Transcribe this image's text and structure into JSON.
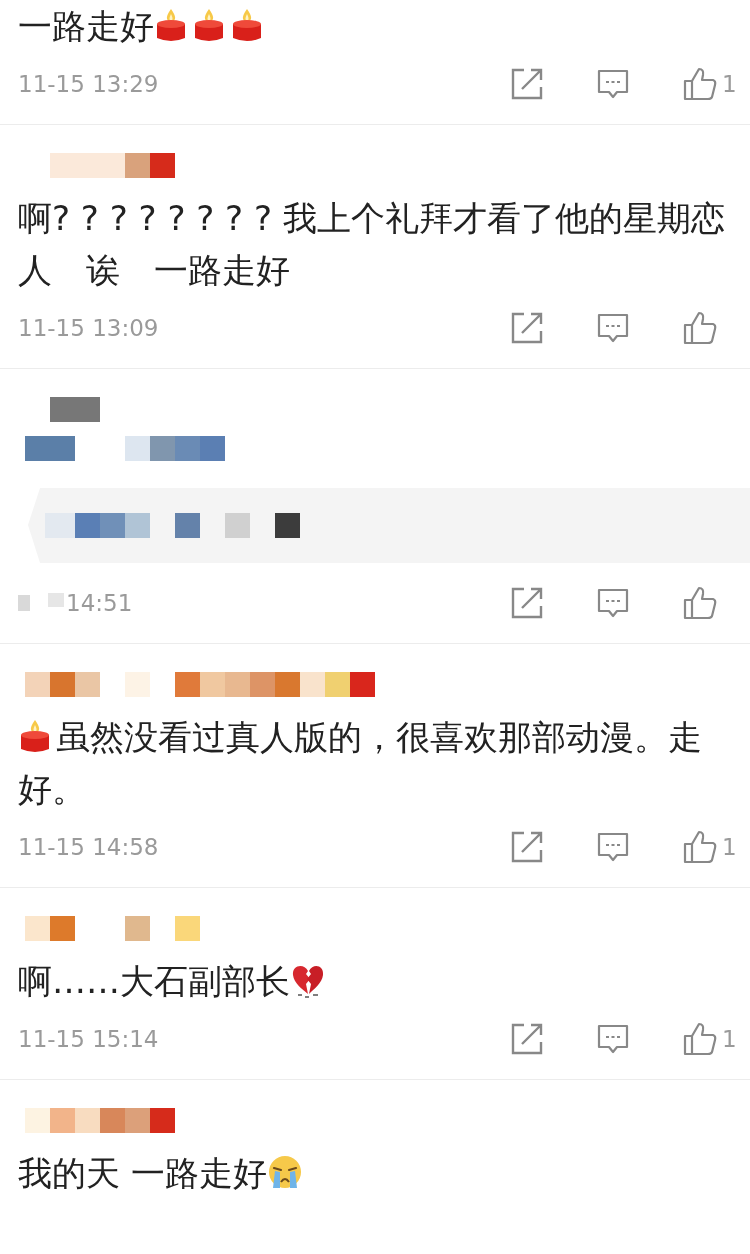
{
  "comments": [
    {
      "kind": "text",
      "segments": [
        {
          "kind": "text",
          "text": "一路走好"
        },
        {
          "kind": "candle"
        },
        {
          "kind": "candle"
        },
        {
          "kind": "candle"
        }
      ],
      "time": "11-15 13:29",
      "likes": "1"
    },
    {
      "kind": "text",
      "segments": [
        {
          "kind": "text",
          "text": "啊? ? ? ? ? ? ? ? 我上个礼拜才看了他的星期恋人　诶　一路走好"
        }
      ],
      "time": "11-15 13:09"
    },
    {
      "kind": "redacted",
      "time": "14:51"
    },
    {
      "kind": "text",
      "segments": [
        {
          "kind": "candle"
        },
        {
          "kind": "text",
          "text": "虽然没看过真人版的，很喜欢那部动漫。走好。"
        }
      ],
      "time": "11-15 14:58",
      "likes": "1"
    },
    {
      "kind": "text",
      "segments": [
        {
          "kind": "text",
          "text": "啊……大石副部长"
        },
        {
          "kind": "heartbreak"
        }
      ],
      "time": "11-15 15:14",
      "likes": "1"
    },
    {
      "kind": "text",
      "segments": [
        {
          "kind": "text",
          "text": "我的天 一路走好"
        },
        {
          "kind": "crying"
        }
      ]
    }
  ]
}
